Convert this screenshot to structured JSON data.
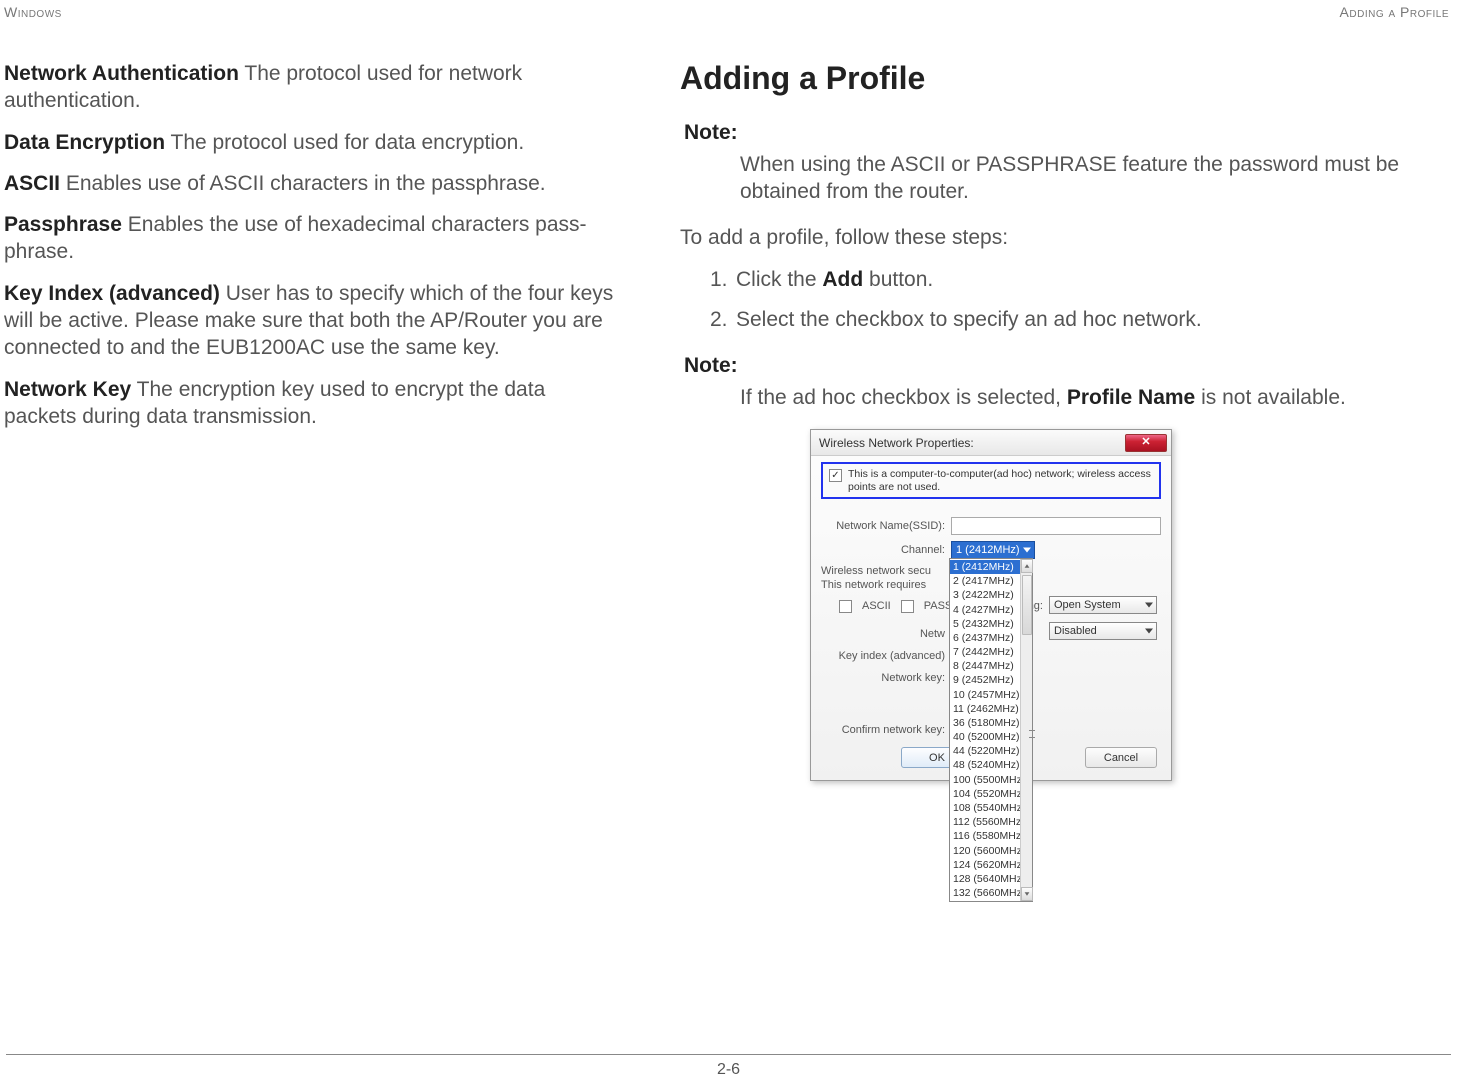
{
  "header": {
    "left": "Windows",
    "right": "Adding a Profile"
  },
  "footer": {
    "page": "2-6"
  },
  "left_col": {
    "defs": [
      {
        "term": "Network Authentication",
        "body": "  The protocol used for network authentication."
      },
      {
        "term": "Data Encryption",
        "body": "  The protocol used for data encryption."
      },
      {
        "term": "ASCII",
        "body": "  Enables use of ASCII characters in the passphrase."
      },
      {
        "term": "Passphrase",
        "body": "  Enables the use of hexadecimal characters pass-phrase."
      },
      {
        "term": "Key Index (advanced)",
        "body": "  User has to specify which of the four keys will be active. Please make sure that both the AP/Router you are connected to and the EUB1200AC use the same key."
      },
      {
        "term": "Network Key",
        "body": "  The encryption key used to encrypt the data packets during data transmission."
      }
    ]
  },
  "right_col": {
    "title": "Adding a Profile",
    "note1_label": "Note:",
    "note1_body": "When using the ASCII or PASSPHRASE feature the password must be obtained from the router.",
    "intro": "To add a profile, follow these steps:",
    "steps": [
      {
        "num": "1.",
        "pre": "Click the ",
        "bold": "Add",
        "post": " button."
      },
      {
        "num": "2.",
        "pre": "Select the checkbox to specify an ad hoc network.",
        "bold": "",
        "post": ""
      }
    ],
    "note2_label": "Note:",
    "note2_body_pre": "If the ad hoc checkbox is selected, ",
    "note2_body_bold": "Profile Name",
    "note2_body_post": " is not available."
  },
  "dialog": {
    "title": "Wireless Network Properties:",
    "close_glyph": "✕",
    "adhoc_checked": "✓",
    "adhoc_text": "This is a computer-to-computer(ad hoc) network; wireless access points are not used.",
    "ssid_label": "Network Name(SSID):",
    "channel_label": "Channel:",
    "channel_selected": "1  (2412MHz)",
    "sec_label": "Wireless network secu",
    "netw_label": "Netw",
    "this_req_label": "This network requires",
    "right_trail": "ving:",
    "auth_value": "Open System",
    "enc_value": "Disabled",
    "ascii_label": "ASCII",
    "pass_label": "PASS",
    "keyidx_label": "Key index (advanced)",
    "netkey_label": "Network key:",
    "confirm_label": "Confirm network key:",
    "ok": "OK",
    "cancel": "Cancel",
    "channel_options": [
      "1  (2412MHz)",
      "2  (2417MHz)",
      "3  (2422MHz)",
      "4  (2427MHz)",
      "5  (2432MHz)",
      "6  (2437MHz)",
      "7  (2442MHz)",
      "8  (2447MHz)",
      "9  (2452MHz)",
      "10 (2457MHz)",
      "11 (2462MHz)",
      "36 (5180MHz)",
      "40 (5200MHz)",
      "44 (5220MHz)",
      "48 (5240MHz)",
      "100 (5500MHz",
      "104 (5520MHz",
      "108 (5540MHz",
      "112 (5560MHz",
      "116 (5580MHz",
      "120 (5600MHz",
      "124 (5620MHz",
      "128 (5640MHz",
      "132 (5660MHz"
    ]
  }
}
